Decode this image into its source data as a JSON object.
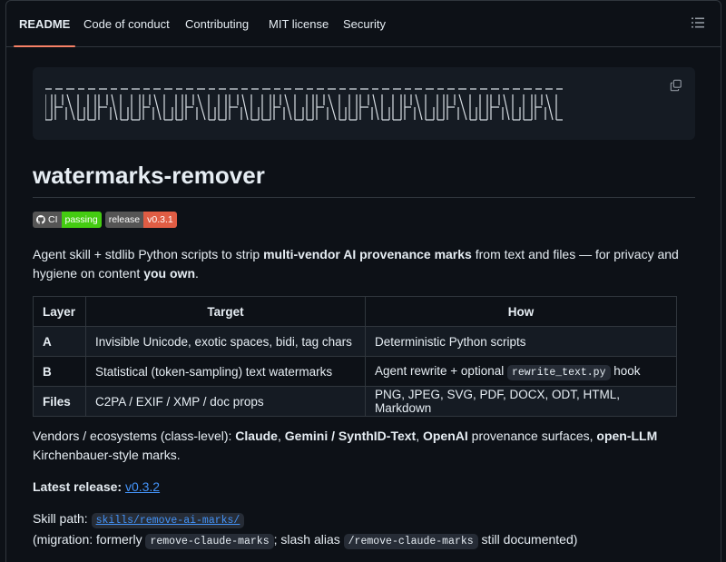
{
  "tabs": [
    "README",
    "Code of conduct",
    "Contributing",
    "MIT license",
    "Security"
  ],
  "title": "watermarks-remover",
  "badges": {
    "ci_label": "CI",
    "ci_status": "passing",
    "release_label": "release",
    "release_version": "v0.3.1"
  },
  "description": {
    "part1": "Agent skill + stdlib Python scripts to strip ",
    "bold1": "multi-vendor AI provenance marks",
    "part2": " from text and files — for privacy and hygiene on content ",
    "bold2": "you own",
    "part3": "."
  },
  "table": {
    "headers": [
      "Layer",
      "Target",
      "How"
    ],
    "rows": [
      {
        "layer": "A",
        "target": "Invisible Unicode, exotic spaces, bidi, tag chars",
        "how": "Deterministic Python scripts"
      },
      {
        "layer": "B",
        "target": "Statistical (token-sampling) text watermarks",
        "how_pre": "Agent rewrite + optional ",
        "how_code": "rewrite_text.py",
        "how_post": " hook"
      },
      {
        "layer": "Files",
        "target": "C2PA / EXIF / XMP / doc props",
        "how": "PNG, JPEG, SVG, PDF, DOCX, ODT, HTML, Markdown"
      }
    ]
  },
  "vendors": {
    "pre": "Vendors / ecosystems (class-level): ",
    "b1": "Claude",
    "s1": ", ",
    "b2": "Gemini / SynthID-Text",
    "s2": ", ",
    "b3": "OpenAI",
    "s3": " provenance surfaces, ",
    "b4": "open-LLM",
    "post": " Kirchenbauer-style marks."
  },
  "latest": {
    "label": "Latest release:",
    "version": "v0.3.2"
  },
  "skill": {
    "label": "Skill path:",
    "path": "skills/remove-ai-marks/",
    "mig_pre": "(migration: formerly ",
    "mig_code1": "remove-claude-marks",
    "mig_mid": "; slash alias ",
    "mig_code2": "/remove-claude-marks",
    "mig_post": " still documented)"
  },
  "icons": {
    "toc": "list-icon",
    "copy": "copy-icon",
    "github": "github-icon"
  },
  "colors": {
    "accent_tab": "#f78166",
    "link": "#4493f8",
    "badge_pass": "#4c1",
    "badge_release": "#e05d44"
  }
}
